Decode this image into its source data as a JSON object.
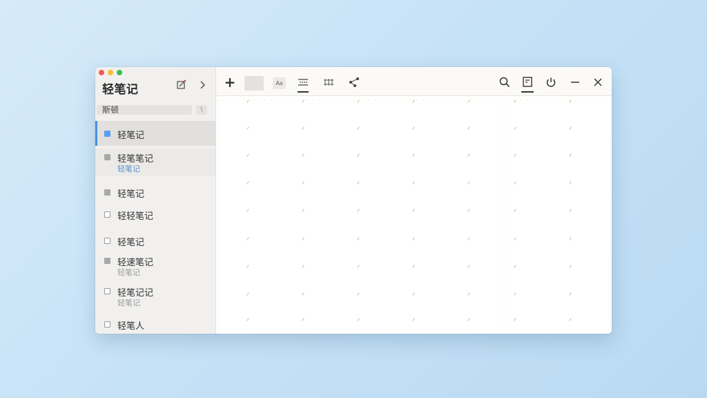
{
  "app": {
    "title": "轻笔记"
  },
  "sidebar": {
    "search": {
      "value": "斯顿",
      "button_glyph": "\\"
    },
    "notes": [
      {
        "title": "轻笔记",
        "subtitle": "",
        "checkbox": "blue",
        "selected": true
      },
      {
        "title": "轻笔笔记",
        "subtitle": "轻笔记",
        "checkbox": "filled",
        "selected": false
      },
      {
        "title": "轻笔记",
        "subtitle": "",
        "checkbox": "filled",
        "selected": false
      },
      {
        "title": "轻轻笔记",
        "subtitle": "",
        "checkbox": "outline",
        "selected": false
      },
      {
        "title": "轻笔记",
        "subtitle": "",
        "checkbox": "outline",
        "selected": false
      },
      {
        "title": "轻速笔记",
        "subtitle": "轻笔记",
        "checkbox": "filled",
        "selected": false
      },
      {
        "title": "轻笔记记",
        "subtitle": "轻笔记",
        "checkbox": "outline",
        "selected": false
      },
      {
        "title": "轻笔人",
        "subtitle": "",
        "checkbox": "outline",
        "selected": false
      }
    ]
  },
  "toolbar": {
    "add_glyph": "+",
    "format_label": "Aa",
    "icons": [
      "add-icon",
      "color-swatch-icon",
      "text-format-icon",
      "list-icon",
      "table-icon",
      "share-icon",
      "search-icon",
      "note-icon",
      "power-icon",
      "minimize-icon",
      "close-icon"
    ]
  },
  "colors": {
    "accent": "#4a8fe0",
    "checkbox_blue": "#5b9ef0",
    "subtitle_blue": "#5b8fc9",
    "grid_dot": "#e5dcae"
  }
}
